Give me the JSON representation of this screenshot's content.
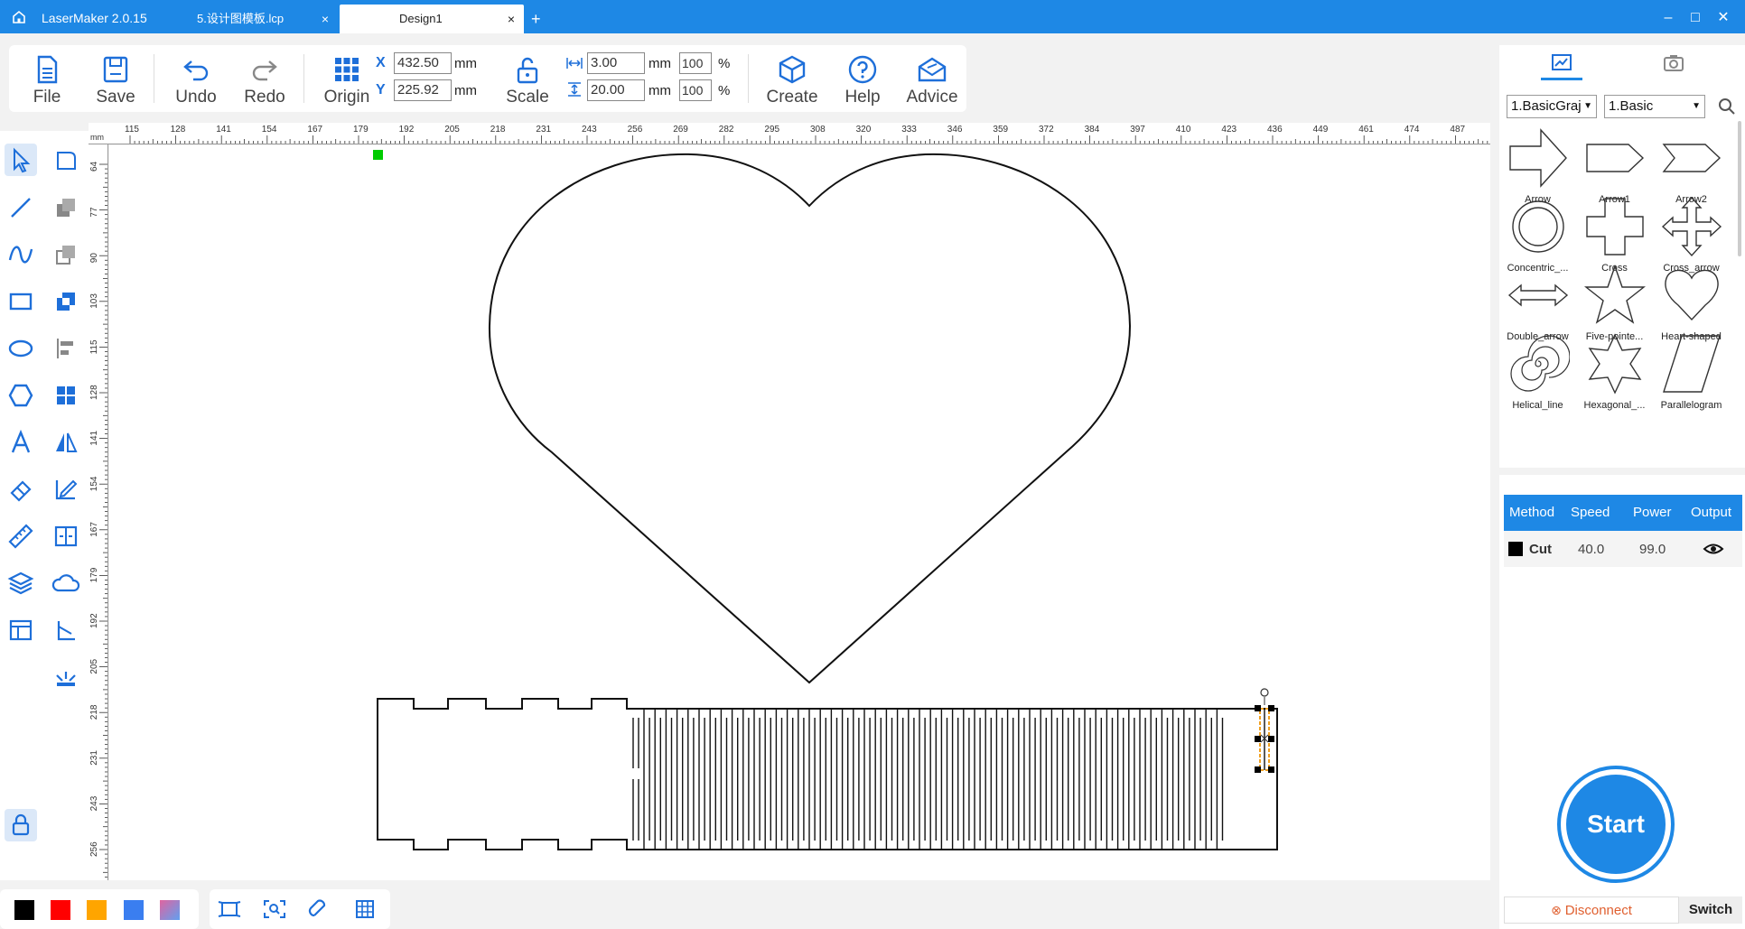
{
  "titlebar": {
    "app_name": "LaserMaker 2.0.15",
    "tabs": [
      {
        "label": "5.设计图模板.lcp",
        "close": "×"
      },
      {
        "label": "Design1",
        "close": "×"
      }
    ],
    "add_tab": "+",
    "minimize": "–",
    "maximize": "□",
    "close": "✕"
  },
  "toolbar": {
    "file": "File",
    "save": "Save",
    "undo": "Undo",
    "redo": "Redo",
    "origin": "Origin",
    "x_label": "X",
    "y_label": "Y",
    "x_value": "432.50",
    "y_value": "225.92",
    "unit": "mm",
    "scale": "Scale",
    "width_value": "3.00",
    "height_value": "20.00",
    "width_pct": "100",
    "height_pct": "100",
    "pct_sign": "%",
    "create": "Create",
    "help": "Help",
    "advice": "Advice"
  },
  "ruler": {
    "unit": "mm",
    "top_labels": [
      "115",
      "128",
      "141",
      "154",
      "167",
      "179",
      "192",
      "205",
      "218",
      "231",
      "243",
      "256",
      "269",
      "282",
      "295",
      "308",
      "320",
      "333",
      "346",
      "359",
      "372",
      "384",
      "397",
      "410",
      "423",
      "436",
      "449",
      "461",
      "474",
      "487"
    ],
    "left_labels": [
      "64",
      "77",
      "90",
      "103",
      "115",
      "128",
      "141",
      "154",
      "167",
      "179",
      "192",
      "205",
      "218",
      "231",
      "243",
      "256"
    ]
  },
  "colors": {
    "accent": "#1e88e5",
    "swatches": [
      "#000000",
      "#ff0000",
      "#ffa500",
      "#3a7ef0",
      "#e064a0"
    ]
  },
  "library": {
    "category": "1.BasicGraj",
    "subcategory": "1.Basic",
    "shapes": [
      {
        "name": "Arrow"
      },
      {
        "name": "Arrow1"
      },
      {
        "name": "Arrow2"
      },
      {
        "name": "Concentric_..."
      },
      {
        "name": "Cross"
      },
      {
        "name": "Cross_arrow"
      },
      {
        "name": "Double_arrow"
      },
      {
        "name": "Five-pointe..."
      },
      {
        "name": "Heart-shaped"
      },
      {
        "name": "Helical_line"
      },
      {
        "name": "Hexagonal_..."
      },
      {
        "name": "Parallelogram"
      }
    ]
  },
  "layers": {
    "headers": {
      "method": "Method",
      "speed": "Speed",
      "power": "Power",
      "output": "Output"
    },
    "rows": [
      {
        "method": "Cut",
        "speed": "40.0",
        "power": "99.0",
        "color": "#000000"
      }
    ]
  },
  "start": {
    "label": "Start"
  },
  "connection": {
    "disconnect": "Disconnect",
    "switch": "Switch"
  }
}
